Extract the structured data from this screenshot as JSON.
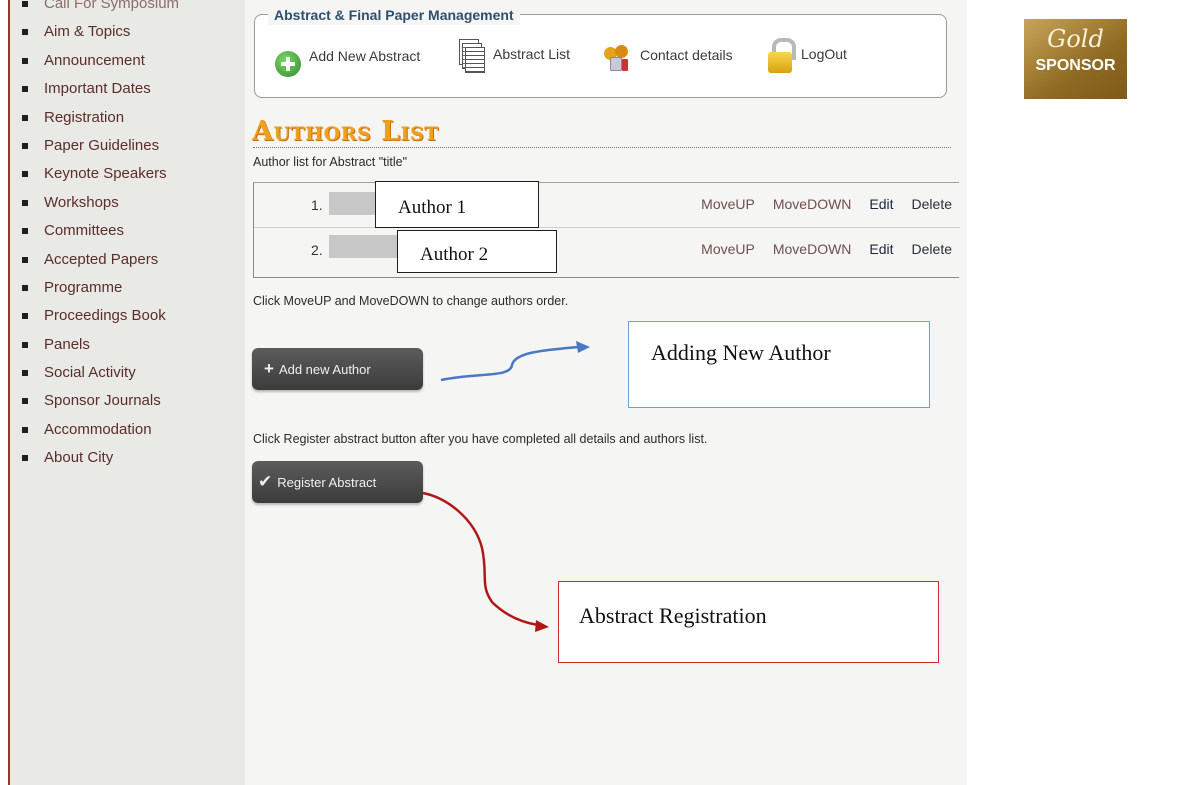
{
  "sidebar": {
    "items": [
      {
        "label": "Call For Symposium"
      },
      {
        "label": "Aim & Topics"
      },
      {
        "label": "Announcement"
      },
      {
        "label": "Important Dates"
      },
      {
        "label": "Registration"
      },
      {
        "label": "Paper Guidelines"
      },
      {
        "label": "Keynote Speakers"
      },
      {
        "label": "Workshops"
      },
      {
        "label": "Committees"
      },
      {
        "label": "Accepted Papers"
      },
      {
        "label": "Programme"
      },
      {
        "label": "Proceedings Book"
      },
      {
        "label": "Panels"
      },
      {
        "label": "Social Activity"
      },
      {
        "label": "Sponsor Journals"
      },
      {
        "label": "Accommodation"
      },
      {
        "label": "About City"
      }
    ]
  },
  "management": {
    "legend": "Abstract & Final Paper Management",
    "add_new_abstract": "Add New Abstract",
    "abstract_list": "Abstract List",
    "contact_details": "Contact details",
    "logout": "LogOut",
    "icons": [
      "plus-circle-icon",
      "document-list-icon",
      "keys-icon",
      "padlock-icon"
    ]
  },
  "authors": {
    "title": "Authors List",
    "subtitle": "Author list for Abstract \"title\"",
    "rows": [
      {
        "number": "1.",
        "name": "Author 1",
        "move_up": "MoveUP",
        "move_down": "MoveDOWN",
        "edit": "Edit",
        "delete": "Delete"
      },
      {
        "number": "2.",
        "name": "Author 2",
        "move_up": "MoveUP",
        "move_down": "MoveDOWN",
        "edit": "Edit",
        "delete": "Delete"
      }
    ],
    "order_hint": "Click MoveUP and MoveDOWN to change authors order.",
    "add_author_button": "Add new Author",
    "register_hint": "Click Register abstract button after you have completed all details and authors list.",
    "register_button": "Register Abstract"
  },
  "annotations": {
    "adding_new_author": "Adding New Author",
    "abstract_registration": "Abstract Registration",
    "adding_color": "#4a78c4",
    "registration_color": "#b01818"
  },
  "sponsor": {
    "tier": "Gold",
    "label": "SPONSOR"
  }
}
